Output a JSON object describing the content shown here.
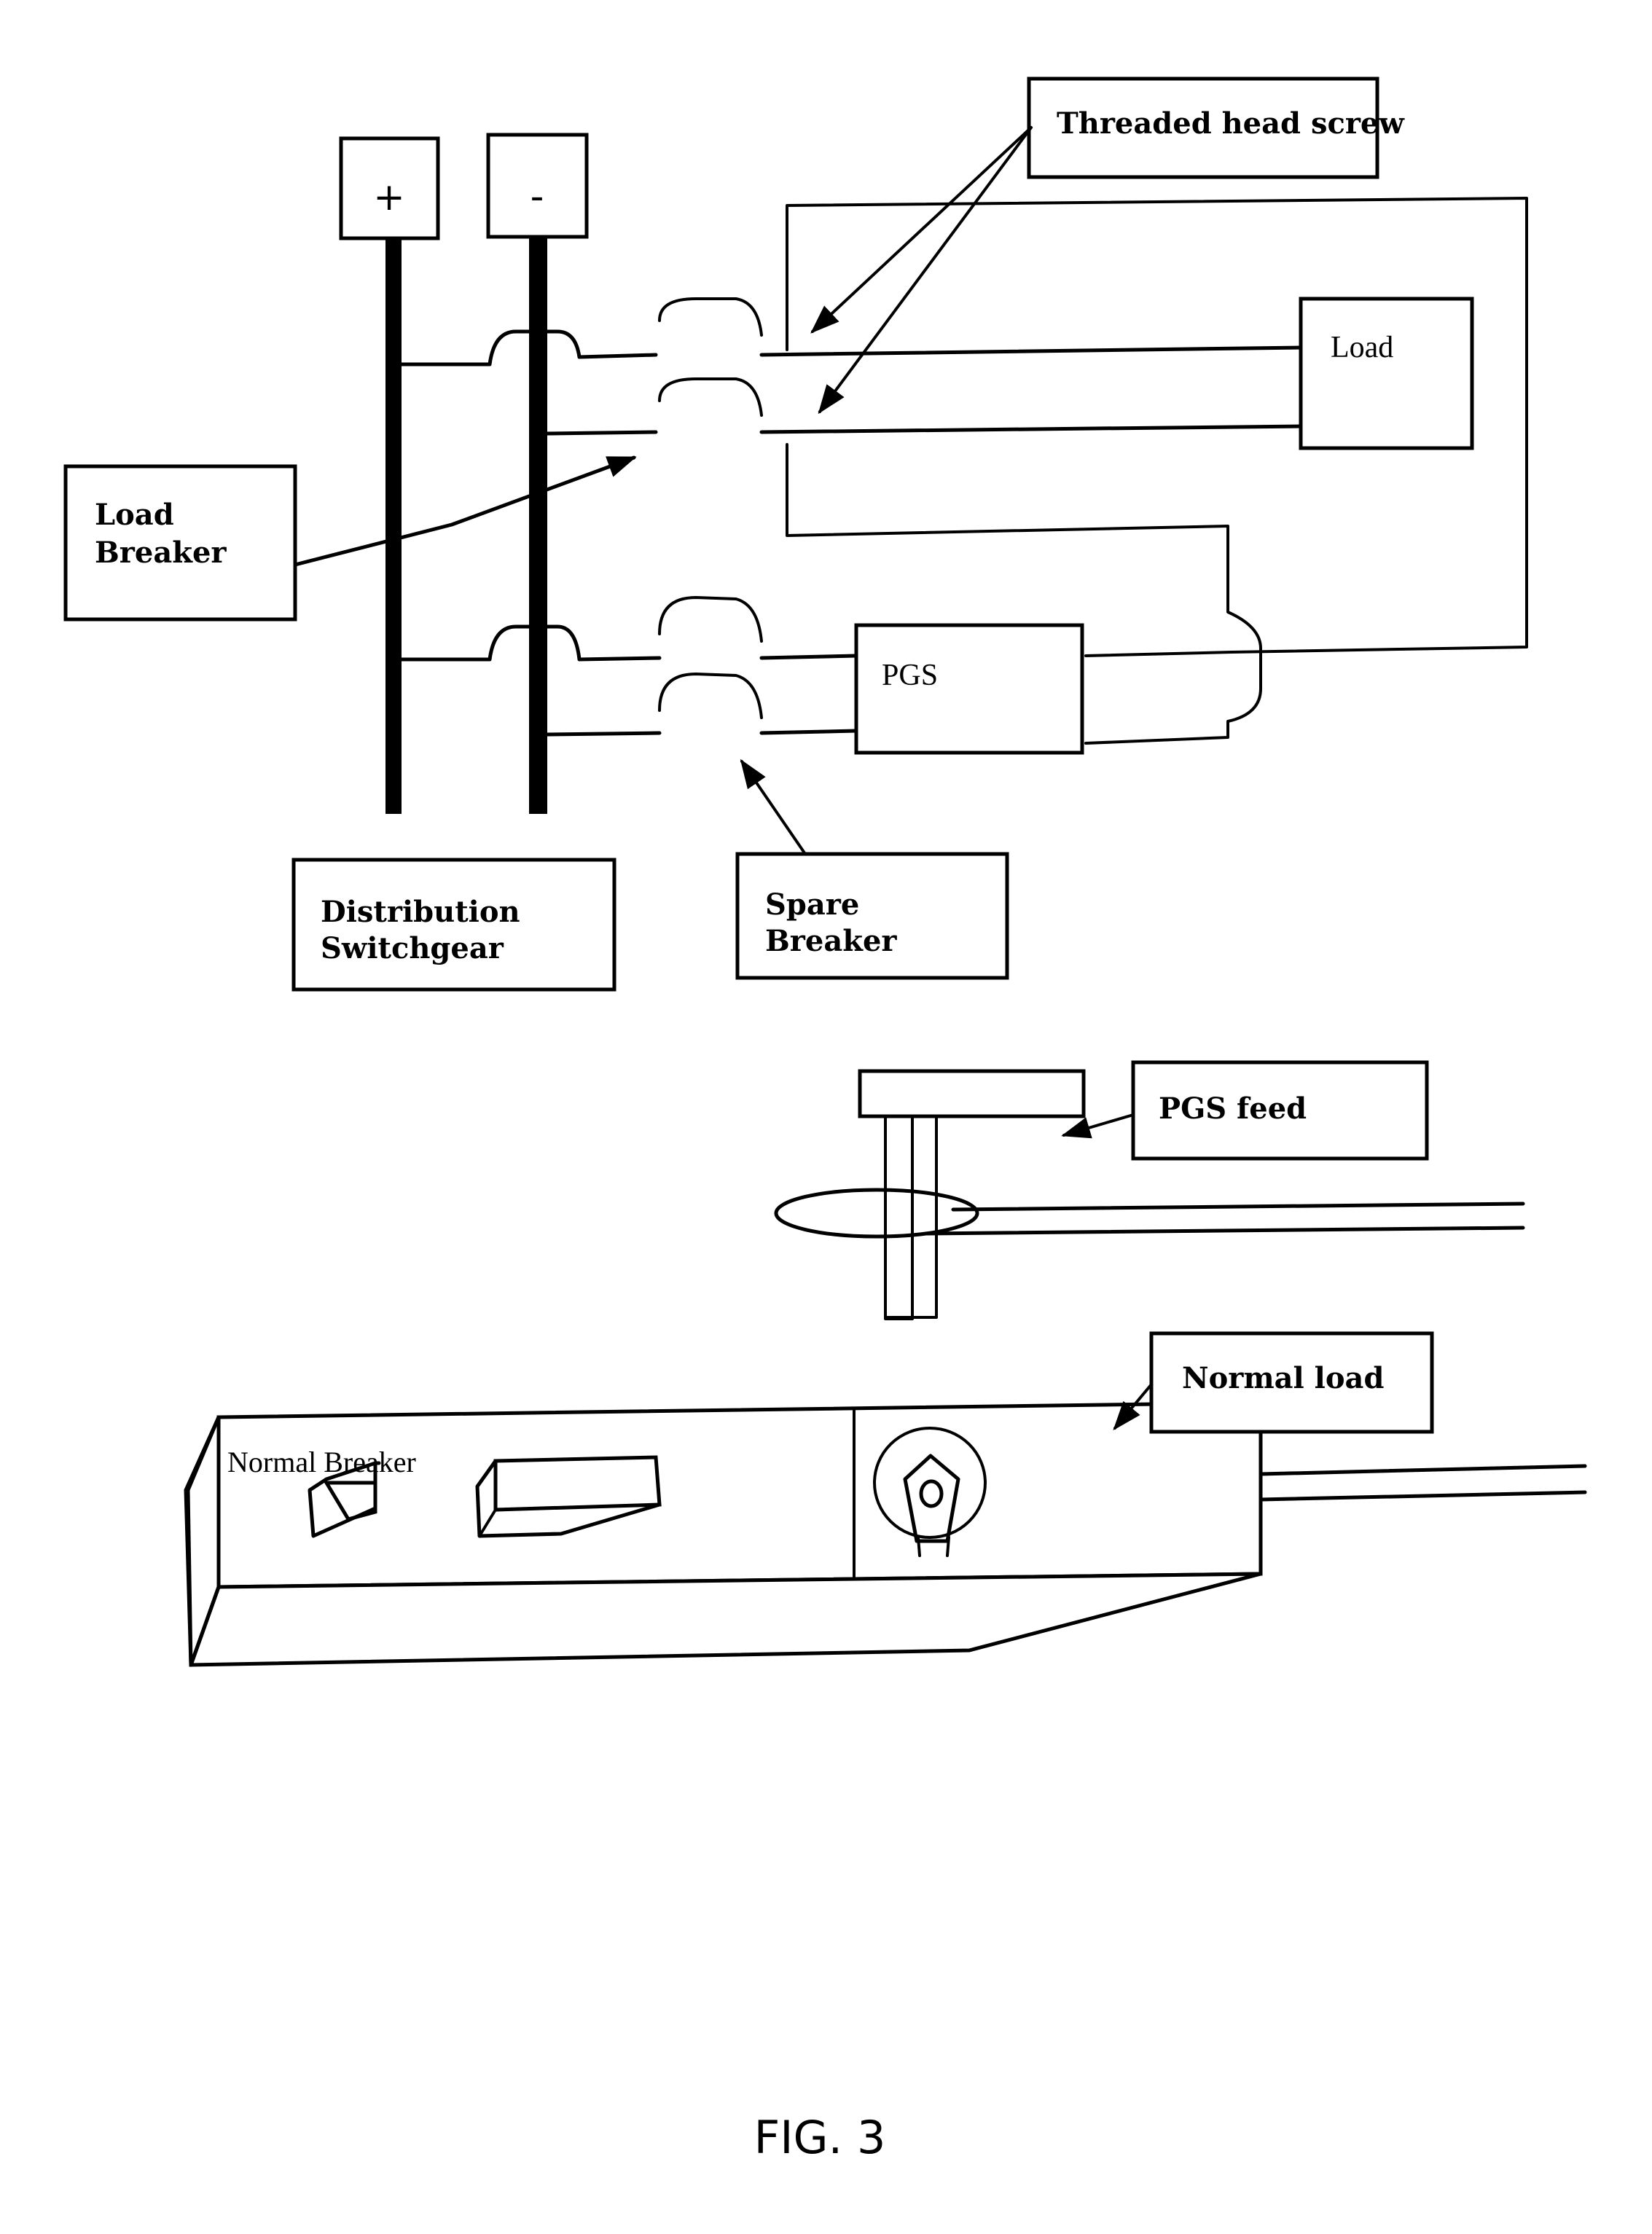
{
  "figure": {
    "caption": "FIG. 3",
    "colors": {
      "ink": "#000000",
      "paper": "#ffffff"
    }
  },
  "schematic": {
    "terminals": {
      "positive": "+",
      "negative": "-"
    },
    "labels": {
      "threaded_head_screw": "Threaded head screw",
      "load_breaker_line1": "Load",
      "load_breaker_line2": "Breaker",
      "load": "Load",
      "pgs": "PGS",
      "distribution_line1": "Distribution",
      "distribution_line2": "Switchgear",
      "spare_breaker_line1": "Spare",
      "spare_breaker_line2": "Breaker"
    }
  },
  "detail": {
    "labels": {
      "pgs_feed": "PGS feed",
      "normal_load": "Normal load",
      "normal_breaker": "Normal Breaker"
    }
  }
}
